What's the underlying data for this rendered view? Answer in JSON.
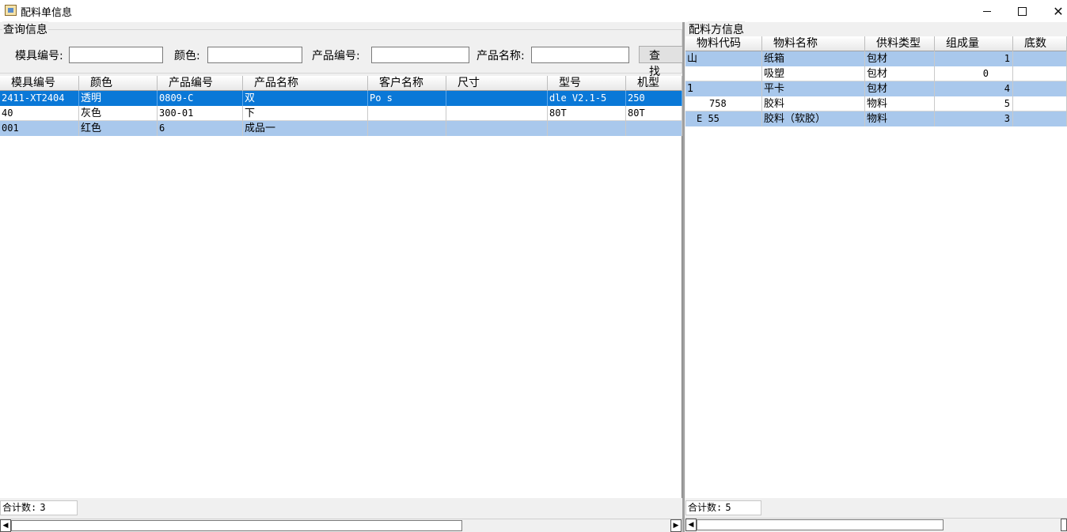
{
  "window": {
    "title": "配料单信息",
    "app_icon": "form-icon",
    "buttons": {
      "minimize_icon": "minimize-icon",
      "maximize_icon": "maximize-icon",
      "close": "✕"
    }
  },
  "query": {
    "group_label": "查询信息",
    "mold_no_label": "模具编号:",
    "mold_no_value": "",
    "color_label": "颜色:",
    "color_value": "",
    "product_no_label": "产品编号:",
    "product_no_value": "",
    "product_name_label": "产品名称:",
    "product_name_value": "",
    "find_button": "查 找"
  },
  "orders": {
    "columns": [
      "模具编号",
      "颜色",
      "产品编号",
      "产品名称",
      "客户名称",
      "尺寸",
      "型号",
      "机型"
    ],
    "rows": [
      {
        "mold_no": "2411-XT2404",
        "color": "透明",
        "product_no": "0809-C",
        "product_name": "双",
        "customer": "Po s",
        "size": "",
        "model": "dle V2.1-5",
        "machine": "250"
      },
      {
        "mold_no": "40",
        "color": "灰色",
        "product_no": "300-01",
        "product_name": "下",
        "customer": "",
        "size": "",
        "model": "80T",
        "machine": "80T"
      },
      {
        "mold_no": "001",
        "color": "红色",
        "product_no": "6",
        "product_name": "成品一",
        "customer": "",
        "size": "",
        "model": "",
        "machine": ""
      }
    ],
    "total_label": "合计数:",
    "total_value": "3"
  },
  "formula": {
    "group_label": "配料方信息",
    "columns": [
      "物料代码",
      "物料名称",
      "供料类型",
      "组成量",
      "底数"
    ],
    "rows": [
      {
        "code": "山",
        "name": "纸箱",
        "type": "包材",
        "qty": "1",
        "base": ""
      },
      {
        "code": "",
        "name": "吸塑",
        "type": "包材",
        "qty": "0",
        "base": ""
      },
      {
        "code": "1",
        "name": "平卡",
        "type": "包材",
        "qty": "4",
        "base": ""
      },
      {
        "code": "758",
        "name": "胶料",
        "type": "物料",
        "qty": "5",
        "base": ""
      },
      {
        "code": "E 55",
        "name": "胶料（软胶）",
        "type": "物料",
        "qty": "3",
        "base": ""
      }
    ],
    "total_label": "合计数:",
    "total_value": "5"
  },
  "scrollbar": {
    "left_arrow": "◀",
    "right_arrow": "▶"
  },
  "colors": {
    "selected_row": "#0a78d7",
    "alt_row": "#a9c8ec",
    "window_bg": "#f0f0f0"
  }
}
